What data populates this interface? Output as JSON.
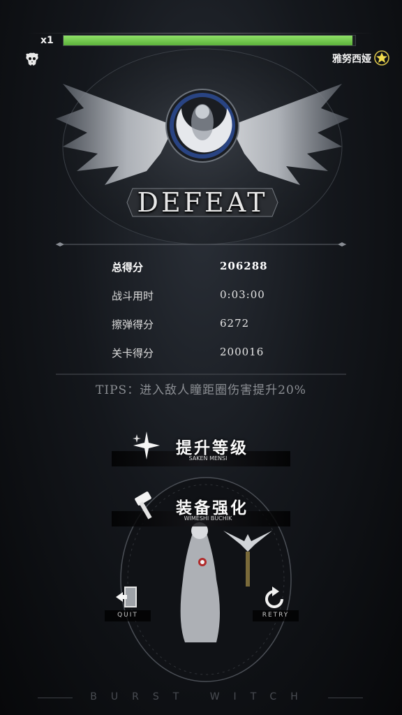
{
  "hud": {
    "multiplier": "x1",
    "hp_fraction": 0.99,
    "player_name": "雅努西娅",
    "accent_green": "#7ccf52"
  },
  "result": {
    "title": "DEFEAT"
  },
  "stats": [
    {
      "label": "总得分",
      "value": "206288"
    },
    {
      "label": "战斗用时",
      "value": "0:03:00"
    },
    {
      "label": "擦弹得分",
      "value": "6272"
    },
    {
      "label": "关卡得分",
      "value": "200016"
    }
  ],
  "tips": "TIPS：进入敌人瞳距圈伤害提升20%",
  "menu": {
    "level_up": {
      "label": "提升等级",
      "sub": "SAKEN MENSI",
      "icon": "sparkle-icon"
    },
    "equip": {
      "label": "装备强化",
      "sub": "WIMESHI BUCHIK",
      "icon": "hammer-icon"
    }
  },
  "buttons": {
    "quit": {
      "label": "QUIT",
      "icon": "exit-door-icon"
    },
    "retry": {
      "label": "RETRY",
      "icon": "retry-arrow-icon"
    }
  },
  "footer": {
    "brand": "BURST WITCH"
  }
}
